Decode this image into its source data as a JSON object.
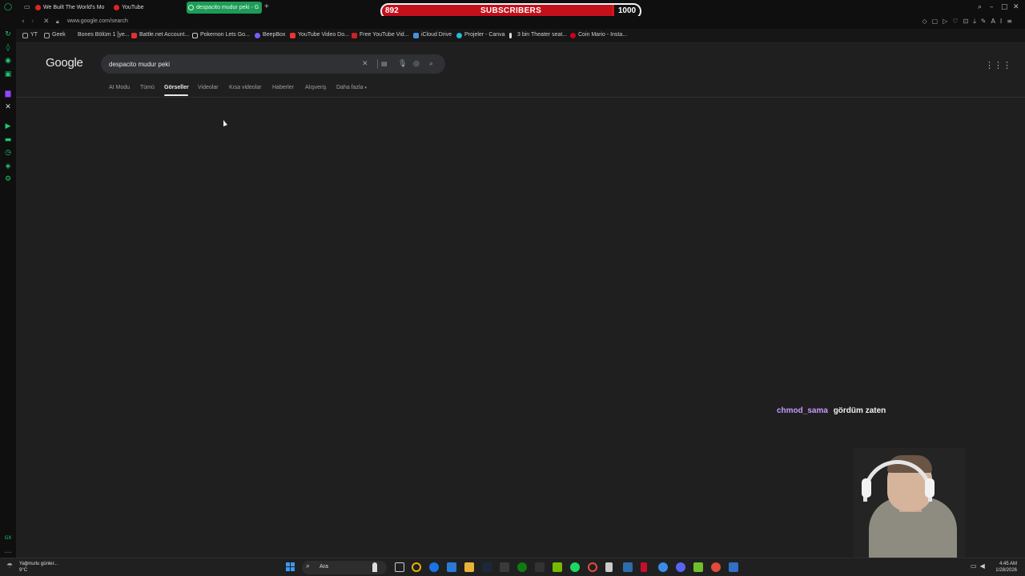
{
  "browser": {
    "tabs": [
      {
        "label": "We Built The World's Mo"
      },
      {
        "label": "YouTube"
      },
      {
        "label": "despacito mudur peki - G"
      }
    ],
    "new_tab": "+",
    "url": "www.google.com/search",
    "bookmarks": [
      {
        "label": "YT"
      },
      {
        "label": "Geek"
      },
      {
        "label": "Bones Bölüm 1 [ye..."
      },
      {
        "label": "Battle.net Account..."
      },
      {
        "label": "Pokemon Lets Go..."
      },
      {
        "label": "BeepBox"
      },
      {
        "label": "YouTube Video Do..."
      },
      {
        "label": "Free YouTube Vid..."
      },
      {
        "label": "iCloud Drive"
      },
      {
        "label": "Projeler - Canva"
      },
      {
        "label": "3 bin Theater seat..."
      },
      {
        "label": "Coin Mario - Insta..."
      }
    ],
    "ai_label": "AI"
  },
  "subscribers": {
    "current": "892",
    "title": "SUBSCRIBERS",
    "goal": "1000",
    "progress": 0.892
  },
  "google": {
    "logo": "Google",
    "query": "despacito mudur peki",
    "tabs": [
      {
        "label": "AI Modu"
      },
      {
        "label": "Tümü"
      },
      {
        "label": "Görseller"
      },
      {
        "label": "Videolar"
      },
      {
        "label": "Kısa videolar"
      },
      {
        "label": "Haberler"
      },
      {
        "label": "Alışveriş"
      },
      {
        "label": "Daha fazla"
      }
    ],
    "active_tab": "Görseller"
  },
  "chat": {
    "user": "chmod_sama",
    "message": "gördüm zaten"
  },
  "taskbar": {
    "weather": "Yağmurlu günler...",
    "temp": "9°C",
    "search": "Ara",
    "time": "4:45 AM",
    "date": "1/28/2026"
  },
  "colors": {
    "accent_green": "#1fc86d",
    "banner_red": "#e0121f",
    "chat_user": "#c79bff"
  }
}
